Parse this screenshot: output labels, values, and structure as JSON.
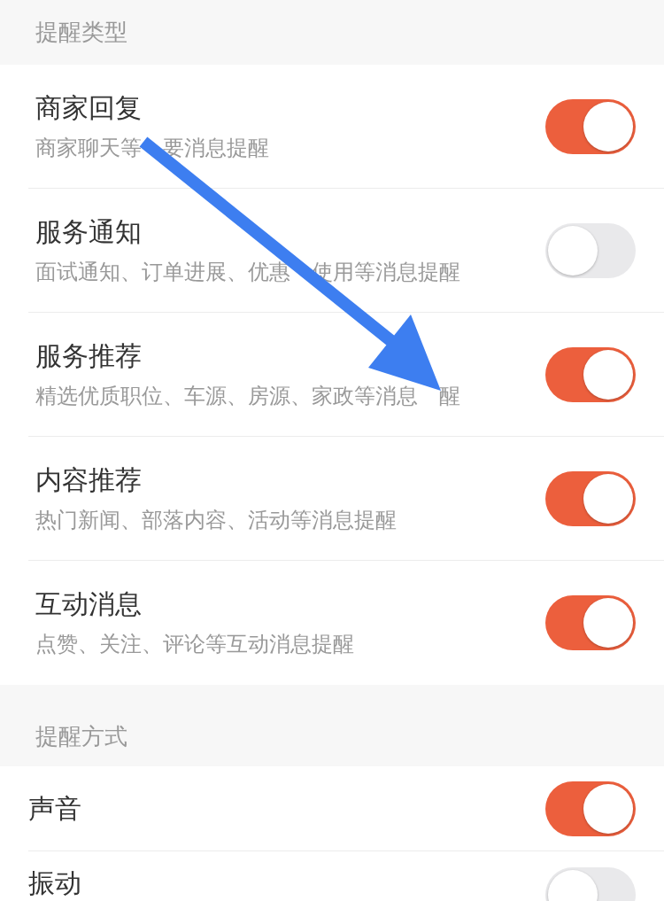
{
  "sections": [
    {
      "header": "提醒类型",
      "rows": [
        {
          "title": "商家回复",
          "subtitle_parts": [
            "商家聊天等",
            "要消息提醒"
          ],
          "on": true
        },
        {
          "title": "服务通知",
          "subtitle_parts": [
            "面试通知、订单进展、优惠",
            "使用等消息提醒"
          ],
          "on": false
        },
        {
          "title": "服务推荐",
          "subtitle_parts": [
            "精选优质职位、车源、房源、家政等消息",
            "醒"
          ],
          "on": true
        },
        {
          "title": "内容推荐",
          "subtitle_parts": [
            "热门新闻、部落内容、活动等消息提醒"
          ],
          "on": true
        },
        {
          "title": "互动消息",
          "subtitle_parts": [
            "点赞、关注、评论等互动消息提醒"
          ],
          "on": true
        }
      ]
    },
    {
      "header": "提醒方式",
      "rows": [
        {
          "title": "声音",
          "on": true
        },
        {
          "title": "振动",
          "on": false
        }
      ]
    }
  ]
}
